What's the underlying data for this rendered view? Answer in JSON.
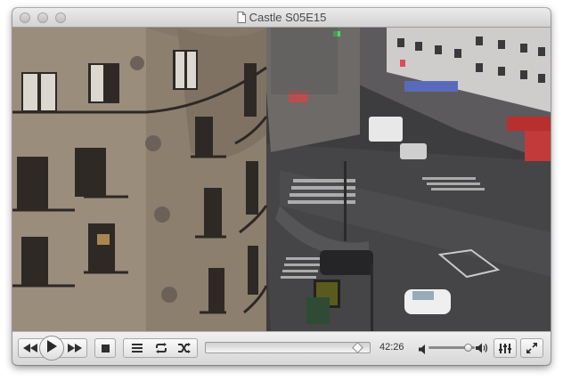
{
  "window": {
    "title": "Castle S05E15",
    "title_icon": "document-icon"
  },
  "playback": {
    "elapsed": "42:26",
    "position_fraction": 0.97,
    "volume_fraction": 0.85,
    "state": "paused"
  },
  "controls": {
    "rewind_icon": "rewind-icon",
    "play_icon": "play-icon",
    "fast_forward_icon": "fast-forward-icon",
    "stop_icon": "stop-icon",
    "playlist_icon": "playlist-icon",
    "repeat_icon": "repeat-icon",
    "shuffle_icon": "shuffle-icon",
    "volume_down_icon": "speaker-low-icon",
    "volume_up_icon": "speaker-high-icon",
    "equalizer_icon": "equalizer-icon",
    "fullscreen_icon": "fullscreen-icon"
  }
}
